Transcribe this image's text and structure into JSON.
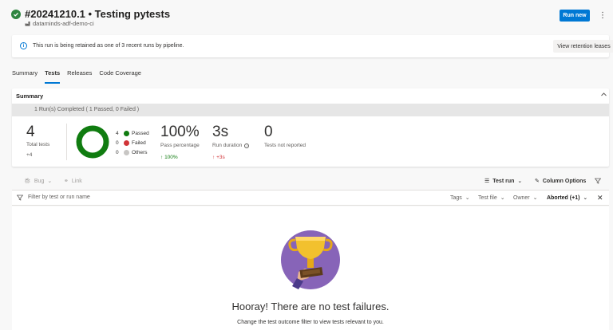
{
  "header": {
    "title": "#20241210.1 • Testing pytests",
    "pipeline": "dataminds-adf-demo-ci",
    "run_new": "Run new",
    "more": "⋮"
  },
  "banner": {
    "text": "This run is being retained as one of 3 recent runs by pipeline.",
    "button": "View retention leases"
  },
  "tabs": [
    {
      "label": "Summary",
      "active": false
    },
    {
      "label": "Tests",
      "active": true
    },
    {
      "label": "Releases",
      "active": false
    },
    {
      "label": "Code Coverage",
      "active": false
    }
  ],
  "summary": {
    "title": "Summary",
    "runs_text": "1 Run(s) Completed ( 1 Passed, 0 Failed )",
    "total_tests": "4",
    "total_label": "Total tests",
    "total_delta": "+4",
    "legend": [
      {
        "count": "4",
        "label": "Passed",
        "color": "#107c10"
      },
      {
        "count": "0",
        "label": "Failed",
        "color": "#d13438"
      },
      {
        "count": "0",
        "label": "Others",
        "color": "#c8c6c4"
      }
    ],
    "pass_pct": "100%",
    "pass_label": "Pass percentage",
    "pass_delta": "100%",
    "duration": "3s",
    "duration_label": "Run duration",
    "duration_delta": "+3s",
    "not_reported": "0",
    "not_reported_label": "Tests not reported"
  },
  "toolbar": {
    "bug": "Bug",
    "link": "Link",
    "test_run": "Test run",
    "column_options": "Column Options"
  },
  "filter": {
    "placeholder": "Filter by test or run name",
    "tags": "Tags",
    "test_file": "Test file",
    "owner": "Owner",
    "outcome": "Aborted (+1)"
  },
  "empty": {
    "title": "Hooray! There are no test failures.",
    "hint": "Change the test outcome filter to view tests relevant to you."
  },
  "colors": {
    "accent": "#0078d4",
    "success": "#107c10",
    "failed": "#d13438",
    "trophy_bg": "#8764b8"
  }
}
